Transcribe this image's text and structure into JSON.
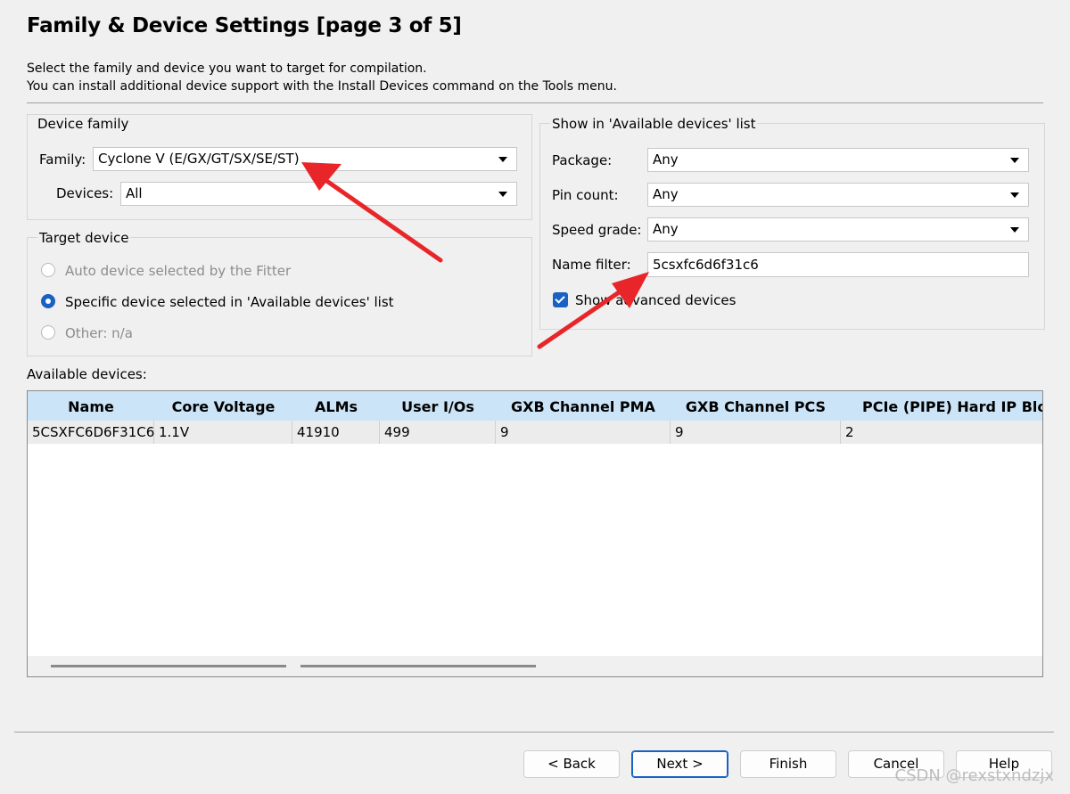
{
  "header": {
    "title": "Family & Device Settings [page 3 of 5]",
    "desc_line1": "Select the family and device you want to target for compilation.",
    "desc_line2": "You can install additional device support with the Install Devices command on the Tools menu."
  },
  "device_family": {
    "group_label": "Device family",
    "family_label": "Family:",
    "family_value": "Cyclone V (E/GX/GT/SX/SE/ST)",
    "devices_label": "Devices:",
    "devices_value": "All"
  },
  "target_device": {
    "group_label": "Target device",
    "option_auto": "Auto device selected by the Fitter",
    "option_specific": "Specific device selected in 'Available devices' list",
    "option_other": "Other:  n/a",
    "selected": "specific"
  },
  "filters": {
    "group_label": "Show in 'Available devices' list",
    "package_label": "Package:",
    "package_value": "Any",
    "pin_count_label": "Pin count:",
    "pin_count_value": "Any",
    "speed_grade_label": "Speed grade:",
    "speed_grade_value": "Any",
    "name_filter_label": "Name filter:",
    "name_filter_value": "5csxfc6d6f31c6",
    "show_advanced_label": "Show advanced devices",
    "show_advanced_checked": true
  },
  "devices_table": {
    "label": "Available devices:",
    "columns": [
      "Name",
      "Core Voltage",
      "ALMs",
      "User I/Os",
      "GXB Channel PMA",
      "GXB Channel PCS",
      "PCIe (PIPE) Hard IP Bloc"
    ],
    "rows": [
      [
        "5CSXFC6D6F31C6",
        "1.1V",
        "41910",
        "499",
        "9",
        "9",
        "2"
      ]
    ]
  },
  "buttons": {
    "back": "< Back",
    "next": "Next >",
    "finish": "Finish",
    "cancel": "Cancel",
    "help": "Help"
  },
  "watermark": "CSDN @rexstxndzjx",
  "colors": {
    "accent": "#1a61c4",
    "header_bg": "#cce4f7",
    "annotation_arrow": "#e8262a"
  }
}
